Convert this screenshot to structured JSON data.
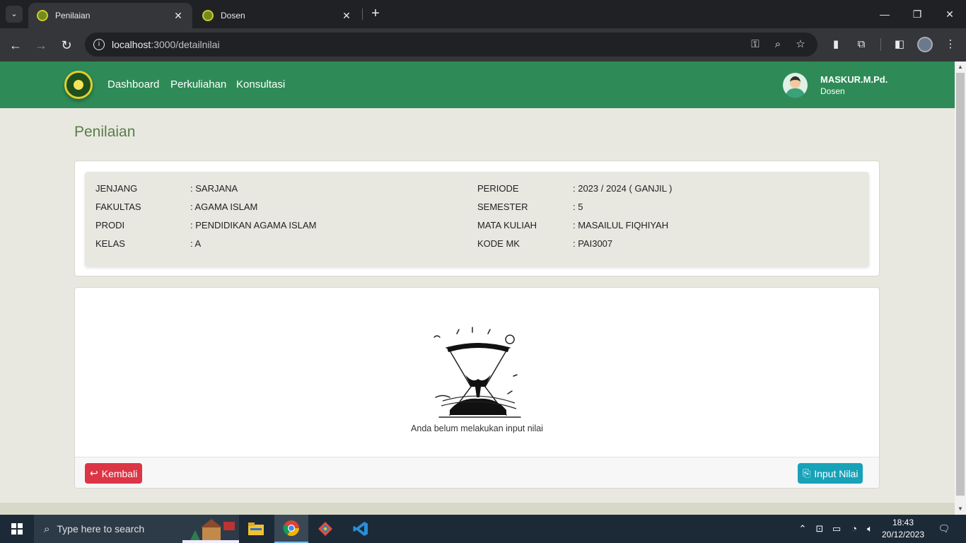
{
  "browser": {
    "tabs": [
      {
        "label": "Penilaian",
        "active": true
      },
      {
        "label": "Dosen",
        "active": false
      }
    ],
    "url_host": "localhost",
    "url_path": ":3000/detailnilai"
  },
  "nav": {
    "links": [
      "Dashboard",
      "Perkuliahan",
      "Konsultasi"
    ],
    "user_name": "MASKUR.M.Pd.",
    "user_role": "Dosen"
  },
  "page_title": "Penilaian",
  "info": {
    "left": [
      {
        "label": "JENJANG",
        "value": ": SARJANA"
      },
      {
        "label": "FAKULTAS",
        "value": ": AGAMA ISLAM"
      },
      {
        "label": "PRODI",
        "value": ": PENDIDIKAN AGAMA ISLAM"
      },
      {
        "label": "KELAS",
        "value": ": A"
      }
    ],
    "right": [
      {
        "label": "PERIODE",
        "value": ": 2023 / 2024 ( GANJIL )"
      },
      {
        "label": "SEMESTER",
        "value": ": 5"
      },
      {
        "label": "MATA KULIAH",
        "value": ": MASAILUL FIQHIYAH"
      },
      {
        "label": "KODE MK",
        "value": ": PAI3007"
      }
    ]
  },
  "empty_state": {
    "message": "Anda belum melakukan input nilai",
    "illustration": "hourglass-illustration"
  },
  "actions": {
    "back_label": "Kembali",
    "input_label": "Input Nilai"
  },
  "colors": {
    "navbar": "#2e8b57",
    "back_button": "#dc3545",
    "input_button": "#17a2b8",
    "title": "#5a7d4a"
  },
  "taskbar": {
    "search_placeholder": "Type here to search",
    "time": "18:43",
    "date": "20/12/2023"
  }
}
